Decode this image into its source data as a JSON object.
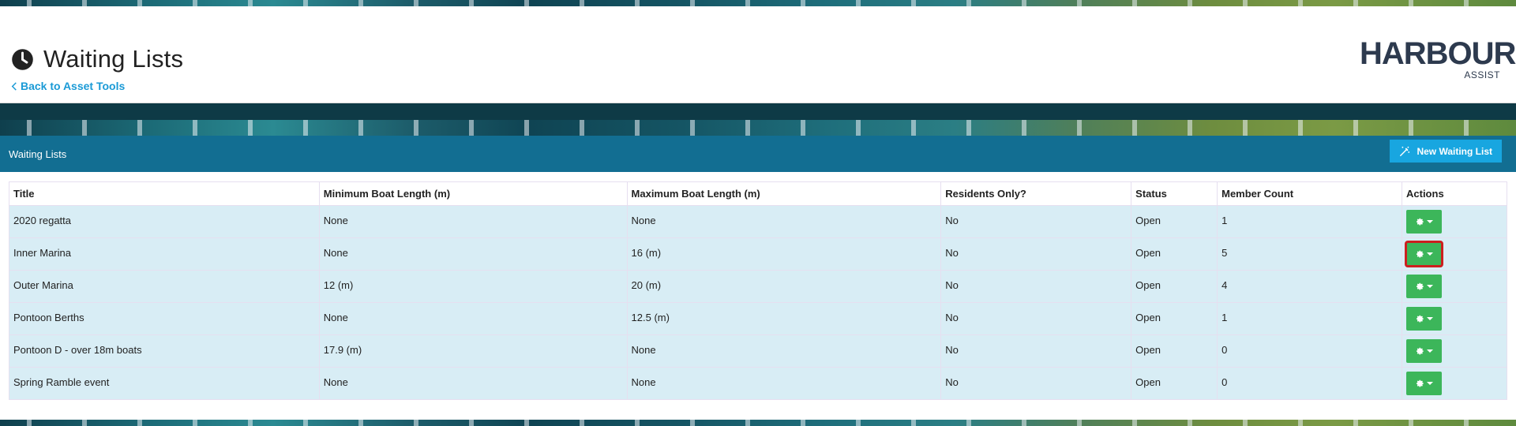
{
  "header": {
    "title": "Waiting Lists",
    "back_link": "Back to Asset Tools",
    "logo_text": "HARBOUR",
    "logo_sub": "ASSIST",
    "title_icon": "clock-icon"
  },
  "panel": {
    "title": "Waiting Lists",
    "new_button": "New Waiting List",
    "new_button_icon": "magic-wand-icon"
  },
  "table": {
    "columns": [
      "Title",
      "Minimum Boat Length (m)",
      "Maximum Boat Length (m)",
      "Residents Only?",
      "Status",
      "Member Count",
      "Actions"
    ],
    "rows": [
      {
        "title": "2020 regatta",
        "min": "None",
        "max": "None",
        "residents": "No",
        "status": "Open",
        "members": "1"
      },
      {
        "title": "Inner Marina",
        "min": "None",
        "max": "16 (m)",
        "residents": "No",
        "status": "Open",
        "members": "5"
      },
      {
        "title": "Outer Marina",
        "min": "12 (m)",
        "max": "20 (m)",
        "residents": "No",
        "status": "Open",
        "members": "4"
      },
      {
        "title": "Pontoon Berths",
        "min": "None",
        "max": "12.5 (m)",
        "residents": "No",
        "status": "Open",
        "members": "1"
      },
      {
        "title": "Pontoon D - over 18m boats",
        "min": "17.9 (m)",
        "max": "None",
        "residents": "No",
        "status": "Open",
        "members": "0"
      },
      {
        "title": "Spring Ramble event",
        "min": "None",
        "max": "None",
        "residents": "No",
        "status": "Open",
        "members": "0"
      }
    ],
    "action_icon": "gear-icon",
    "highlighted_row": 1
  },
  "colors": {
    "panel_header": "#126e92",
    "new_button": "#18a6e0",
    "action_button": "#3cb65a",
    "row_background": "#d8edf5",
    "link": "#1a9ad6",
    "highlight": "#cc1f1f"
  }
}
